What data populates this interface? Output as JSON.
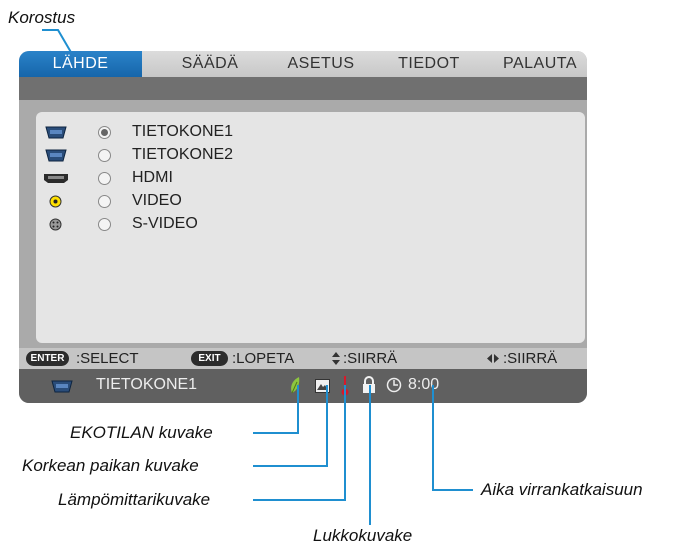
{
  "callouts": {
    "highlight": "Korostus",
    "eco": "EKOTILAN kuvake",
    "altitude": "Korkean paikan kuvake",
    "thermometer": "Lämpömittarikuvake",
    "lock": "Lukkokuvake",
    "timer": "Aika virrankatkaisuun"
  },
  "tabs": [
    {
      "label": "LÄHDE",
      "active": true
    },
    {
      "label": "SÄÄDÄ",
      "active": false
    },
    {
      "label": "ASETUS",
      "active": false
    },
    {
      "label": "TIEDOT",
      "active": false
    },
    {
      "label": "PALAUTA",
      "active": false
    }
  ],
  "sources": [
    {
      "label": "TIETOKONE1",
      "icon": "vga-connector-icon",
      "selected": true
    },
    {
      "label": "TIETOKONE2",
      "icon": "vga-connector-icon",
      "selected": false
    },
    {
      "label": "HDMI",
      "icon": "hdmi-connector-icon",
      "selected": false
    },
    {
      "label": "VIDEO",
      "icon": "composite-video-icon",
      "selected": false
    },
    {
      "label": "S-VIDEO",
      "icon": "s-video-icon",
      "selected": false
    }
  ],
  "help": {
    "enter_key": "ENTER",
    "enter_label": ":SELECT",
    "exit_key": "EXIT",
    "exit_label": ":LOPETA",
    "updown_label": ":SIIRRÄ",
    "leftright_label": ":SIIRRÄ"
  },
  "status": {
    "source": "TIETOKONE1",
    "timer": "8:00"
  },
  "colors": {
    "tab_active": "#1f74bd",
    "callout_line": "#1f8fd0",
    "eco_icon": "#8dc63f",
    "thermometer": "#d7192a"
  }
}
